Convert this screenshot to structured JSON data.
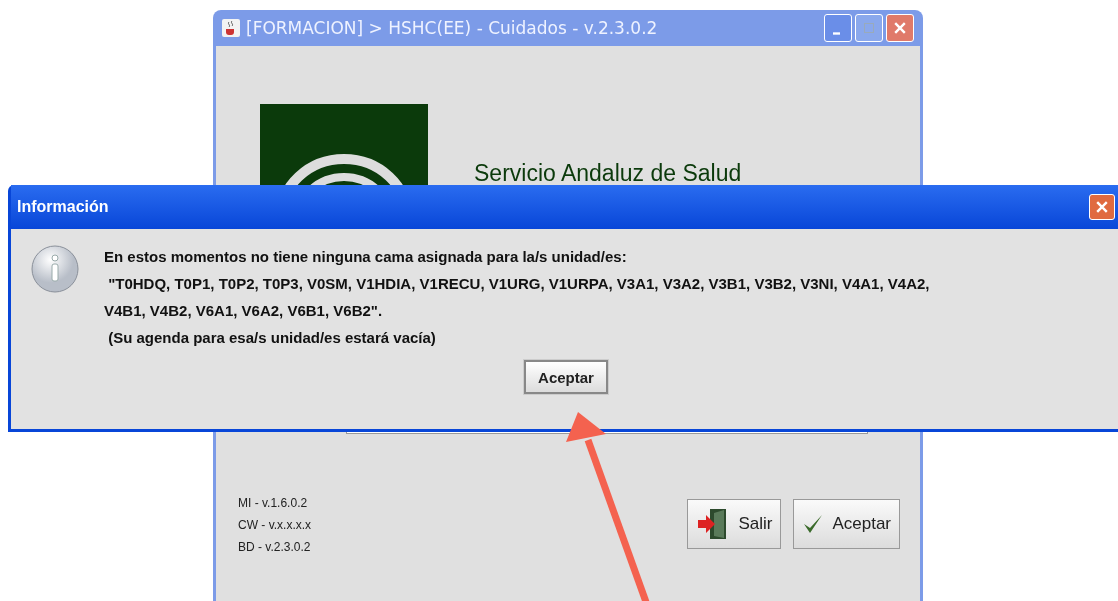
{
  "main_window": {
    "title": "[FORMACION] > HSHC(EE) - Cuidados - v.2.3.0.2",
    "org_name": "Servicio Andaluz de Salud",
    "versions": [
      "MI - v.1.6.0.2",
      "CW - v.x.x.x.x",
      "BD - v.2.3.0.2"
    ],
    "buttons": [
      {
        "kind": "exit",
        "label": "Salir"
      },
      {
        "kind": "ok",
        "label": "Aceptar"
      }
    ]
  },
  "dialog": {
    "title": "Información",
    "message_lines": [
      "En estos momentos no tiene ninguna cama asignada para la/s unidad/es:",
      " \"T0HDQ, T0P1, T0P2, T0P3, V0SM, V1HDIA, V1RECU, V1URG, V1URPA, V3A1, V3A2, V3B1, V3B2, V3NI, V4A1, V4A2,",
      "V4B1, V4B2, V6A1, V6A2, V6B1, V6B2\".",
      " (Su agenda para esa/s unidad/es estará vacía)"
    ],
    "button": "Aceptar"
  }
}
